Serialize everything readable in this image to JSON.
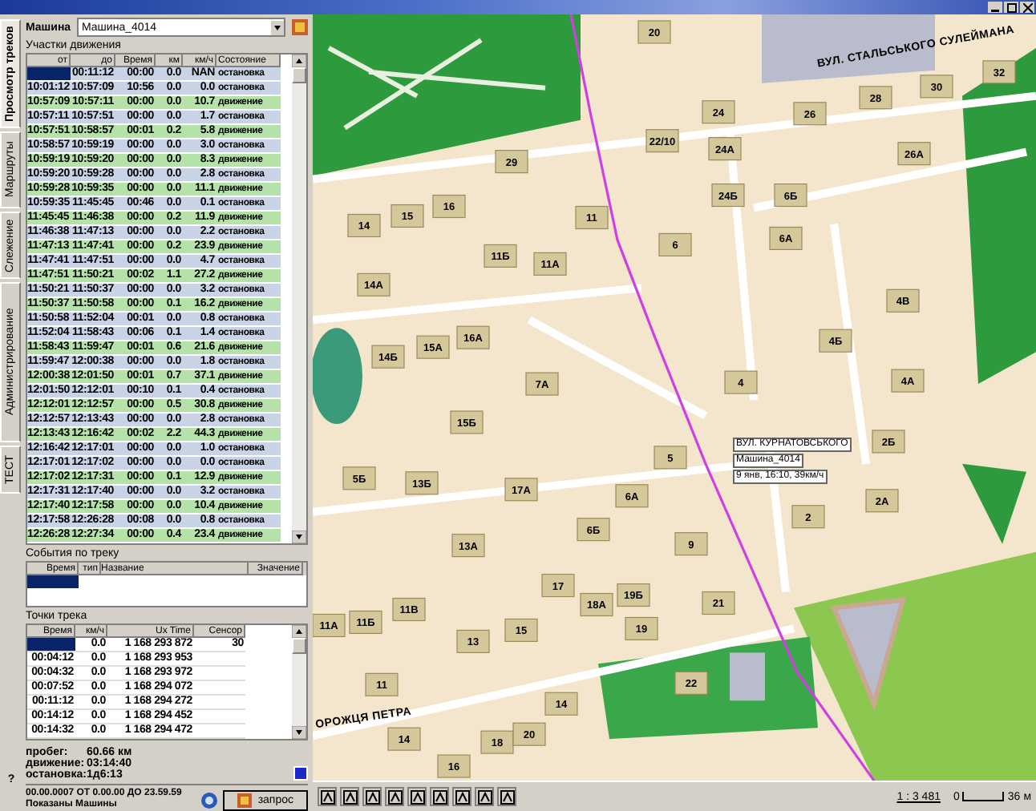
{
  "sidebar_tabs": [
    {
      "label": "Просмотр треков",
      "selected": true
    },
    {
      "label": "Маршруты",
      "selected": false
    },
    {
      "label": "Слежение",
      "selected": false
    },
    {
      "label": "Администрирование",
      "selected": false
    },
    {
      "label": "ТЕСТ",
      "selected": false
    }
  ],
  "vehicle": {
    "label": "Машина",
    "value": "Машина_4014"
  },
  "segments": {
    "title": "Участки движения",
    "columns": [
      "от",
      "до",
      "Время",
      "км",
      "км/ч",
      "Состояние"
    ],
    "rows": [
      {
        "to": "00:11:12",
        "time": "00:00",
        "km": "0.0",
        "speed": "NAN",
        "state": "остановка",
        "moving": false,
        "selected": true
      },
      {
        "from": "10:01:12",
        "to": "10:57:09",
        "time": "10:56",
        "km": "0.0",
        "speed": "0.0",
        "state": "остановка",
        "moving": false,
        "selected": false
      },
      {
        "from": "10:57:09",
        "to": "10:57:11",
        "time": "00:00",
        "km": "0.0",
        "speed": "10.7",
        "state": "движение",
        "moving": true,
        "selected": false
      },
      {
        "from": "10:57:11",
        "to": "10:57:51",
        "time": "00:00",
        "km": "0.0",
        "speed": "1.7",
        "state": "остановка",
        "moving": false,
        "selected": false
      },
      {
        "from": "10:57:51",
        "to": "10:58:57",
        "time": "00:01",
        "km": "0.2",
        "speed": "5.8",
        "state": "движение",
        "moving": true,
        "selected": false
      },
      {
        "from": "10:58:57",
        "to": "10:59:19",
        "time": "00:00",
        "km": "0.0",
        "speed": "3.0",
        "state": "остановка",
        "moving": false,
        "selected": false
      },
      {
        "from": "10:59:19",
        "to": "10:59:20",
        "time": "00:00",
        "km": "0.0",
        "speed": "8.3",
        "state": "движение",
        "moving": true,
        "selected": false
      },
      {
        "from": "10:59:20",
        "to": "10:59:28",
        "time": "00:00",
        "km": "0.0",
        "speed": "2.8",
        "state": "остановка",
        "moving": false,
        "selected": false
      },
      {
        "from": "10:59:28",
        "to": "10:59:35",
        "time": "00:00",
        "km": "0.0",
        "speed": "11.1",
        "state": "движение",
        "moving": true,
        "selected": false
      },
      {
        "from": "10:59:35",
        "to": "11:45:45",
        "time": "00:46",
        "km": "0.0",
        "speed": "0.1",
        "state": "остановка",
        "moving": false,
        "selected": false
      },
      {
        "from": "11:45:45",
        "to": "11:46:38",
        "time": "00:00",
        "km": "0.2",
        "speed": "11.9",
        "state": "движение",
        "moving": true,
        "selected": false
      },
      {
        "from": "11:46:38",
        "to": "11:47:13",
        "time": "00:00",
        "km": "0.0",
        "speed": "2.2",
        "state": "остановка",
        "moving": false,
        "selected": false
      },
      {
        "from": "11:47:13",
        "to": "11:47:41",
        "time": "00:00",
        "km": "0.2",
        "speed": "23.9",
        "state": "движение",
        "moving": true,
        "selected": false
      },
      {
        "from": "11:47:41",
        "to": "11:47:51",
        "time": "00:00",
        "km": "0.0",
        "speed": "4.7",
        "state": "остановка",
        "moving": false,
        "selected": false
      },
      {
        "from": "11:47:51",
        "to": "11:50:21",
        "time": "00:02",
        "km": "1.1",
        "speed": "27.2",
        "state": "движение",
        "moving": true,
        "selected": false
      },
      {
        "from": "11:50:21",
        "to": "11:50:37",
        "time": "00:00",
        "km": "0.0",
        "speed": "3.2",
        "state": "остановка",
        "moving": false,
        "selected": false
      },
      {
        "from": "11:50:37",
        "to": "11:50:58",
        "time": "00:00",
        "km": "0.1",
        "speed": "16.2",
        "state": "движение",
        "moving": true,
        "selected": false
      },
      {
        "from": "11:50:58",
        "to": "11:52:04",
        "time": "00:01",
        "km": "0.0",
        "speed": "0.8",
        "state": "остановка",
        "moving": false,
        "selected": false
      },
      {
        "from": "11:52:04",
        "to": "11:58:43",
        "time": "00:06",
        "km": "0.1",
        "speed": "1.4",
        "state": "остановка",
        "moving": false,
        "selected": false
      },
      {
        "from": "11:58:43",
        "to": "11:59:47",
        "time": "00:01",
        "km": "0.6",
        "speed": "21.6",
        "state": "движение",
        "moving": true,
        "selected": false
      },
      {
        "from": "11:59:47",
        "to": "12:00:38",
        "time": "00:00",
        "km": "0.0",
        "speed": "1.8",
        "state": "остановка",
        "moving": false,
        "selected": false
      },
      {
        "from": "12:00:38",
        "to": "12:01:50",
        "time": "00:01",
        "km": "0.7",
        "speed": "37.1",
        "state": "движение",
        "moving": true,
        "selected": false
      },
      {
        "from": "12:01:50",
        "to": "12:12:01",
        "time": "00:10",
        "km": "0.1",
        "speed": "0.4",
        "state": "остановка",
        "moving": false,
        "selected": false
      },
      {
        "from": "12:12:01",
        "to": "12:12:57",
        "time": "00:00",
        "km": "0.5",
        "speed": "30.8",
        "state": "движение",
        "moving": true,
        "selected": false
      },
      {
        "from": "12:12:57",
        "to": "12:13:43",
        "time": "00:00",
        "km": "0.0",
        "speed": "2.8",
        "state": "остановка",
        "moving": false,
        "selected": false
      },
      {
        "from": "12:13:43",
        "to": "12:16:42",
        "time": "00:02",
        "km": "2.2",
        "speed": "44.3",
        "state": "движение",
        "moving": true,
        "selected": false
      },
      {
        "from": "12:16:42",
        "to": "12:17:01",
        "time": "00:00",
        "km": "0.0",
        "speed": "1.0",
        "state": "остановка",
        "moving": false,
        "selected": false
      },
      {
        "from": "12:17:01",
        "to": "12:17:02",
        "time": "00:00",
        "km": "0.0",
        "speed": "0.0",
        "state": "остановка",
        "moving": false,
        "selected": false
      },
      {
        "from": "12:17:02",
        "to": "12:17:31",
        "time": "00:00",
        "km": "0.1",
        "speed": "12.9",
        "state": "движение",
        "moving": true,
        "selected": false
      },
      {
        "from": "12:17:31",
        "to": "12:17:40",
        "time": "00:00",
        "km": "0.0",
        "speed": "3.2",
        "state": "остановка",
        "moving": false,
        "selected": false
      },
      {
        "from": "12:17:40",
        "to": "12:17:58",
        "time": "00:00",
        "km": "0.0",
        "speed": "10.4",
        "state": "движение",
        "moving": true,
        "selected": false
      },
      {
        "from": "12:17:58",
        "to": "12:26:28",
        "time": "00:08",
        "km": "0.0",
        "speed": "0.8",
        "state": "остановка",
        "moving": false,
        "selected": false
      },
      {
        "from": "12:26:28",
        "to": "12:27:34",
        "time": "00:00",
        "km": "0.4",
        "speed": "23.4",
        "state": "движение",
        "moving": true,
        "selected": false
      }
    ]
  },
  "events": {
    "title": "События по треку",
    "columns": [
      "Время",
      "тип",
      "Название",
      "Значение"
    ],
    "rows": [
      {
        "selected": true
      }
    ]
  },
  "points": {
    "title": "Точки трека",
    "columns": [
      "Время",
      "км/ч",
      "Ux Time",
      "Сенсор"
    ],
    "rows": [
      {
        "speed": "0.0",
        "unix": "1 168 293 872",
        "value": "30",
        "selected": true
      },
      {
        "time": "00:04:12",
        "speed": "0.0",
        "unix": "1 168 293 953",
        "selected": false
      },
      {
        "time": "00:04:32",
        "speed": "0.0",
        "unix": "1 168 293 972",
        "selected": false
      },
      {
        "time": "00:07:52",
        "speed": "0.0",
        "unix": "1 168 294 072",
        "selected": false
      },
      {
        "time": "00:11:12",
        "speed": "0.0",
        "unix": "1 168 294 272",
        "selected": false
      },
      {
        "time": "00:14:12",
        "speed": "0.0",
        "unix": "1 168 294 452",
        "selected": false
      },
      {
        "time": "00:14:32",
        "speed": "0.0",
        "unix": "1 168 294 472",
        "selected": false
      }
    ]
  },
  "summary": [
    {
      "label": "пробег:",
      "value": "60.66 км"
    },
    {
      "label": "движение:",
      "value": "03:14:40"
    },
    {
      "label": "остановка:",
      "value": "1д6:13"
    }
  ],
  "help": "?",
  "status": {
    "period": "00.00.0007 ОТ 0.00.00 ДО 23.59.59",
    "shown": "Показаны Машины"
  },
  "query_button": "запрос",
  "map": {
    "streets": [
      "ВУЛ. СТАЛЬСЬКОГО СУЛЕЙМАНА",
      "ОРОЖЦЯ ПЕТРА"
    ],
    "labels": [
      "20",
      "22/10",
      "24",
      "24А",
      "26",
      "28",
      "30",
      "32",
      "26А",
      "29",
      "24Б",
      "6Б",
      "6А",
      "6",
      "11",
      "14",
      "15",
      "16",
      "11Б",
      "11А",
      "14А",
      "4В",
      "4Б",
      "4",
      "4А",
      "14Б",
      "15А",
      "16А",
      "7А",
      "15Б",
      "5Б",
      "13Б",
      "17А",
      "5",
      "6А",
      "6Б",
      "13А",
      "9",
      "2Б",
      "2А",
      "2",
      "17",
      "18А",
      "19Б",
      "21",
      "19",
      "11А",
      "11Б",
      "11В",
      "13",
      "15",
      "11",
      "22",
      "14",
      "14",
      "18",
      "20",
      "16"
    ],
    "tooltip": [
      "ВУЛ. КУРНАТОВСЬКОГО",
      "Машина_4014",
      "9 янв, 16:10, 39км/ч"
    ]
  },
  "scale": {
    "ratio": "1 : 3 481",
    "start": "0",
    "end": "36",
    "unit": "м"
  }
}
